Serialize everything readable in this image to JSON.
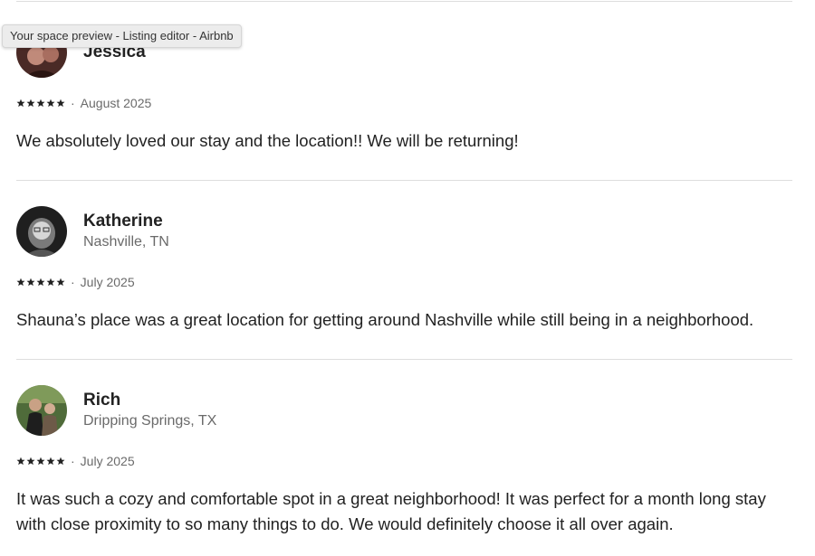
{
  "tooltip": {
    "text": "Your space preview - Listing editor - Airbnb"
  },
  "reviews": [
    {
      "name": "Jessica",
      "location": "",
      "rating": 5,
      "date": "August 2025",
      "text": "We absolutely loved our stay and the location!! We will be returning!"
    },
    {
      "name": "Katherine",
      "location": "Nashville, TN",
      "rating": 5,
      "date": "July 2025",
      "text": "Shauna’s place was a great location for getting around Nashville while still being in a neighborhood."
    },
    {
      "name": "Rich",
      "location": "Dripping Springs, TX",
      "rating": 5,
      "date": "July 2025",
      "text": "It was such a cozy and comfortable spot in a great neighborhood! It was perfect for a month long stay with close proximity to so many things to do. We would definitely choose it all over again."
    }
  ],
  "meta_separator": "·",
  "icons": {
    "star": "star-icon"
  },
  "colors": {
    "text": "#222222",
    "muted": "#6a6a6a",
    "divider": "#dddddd"
  }
}
